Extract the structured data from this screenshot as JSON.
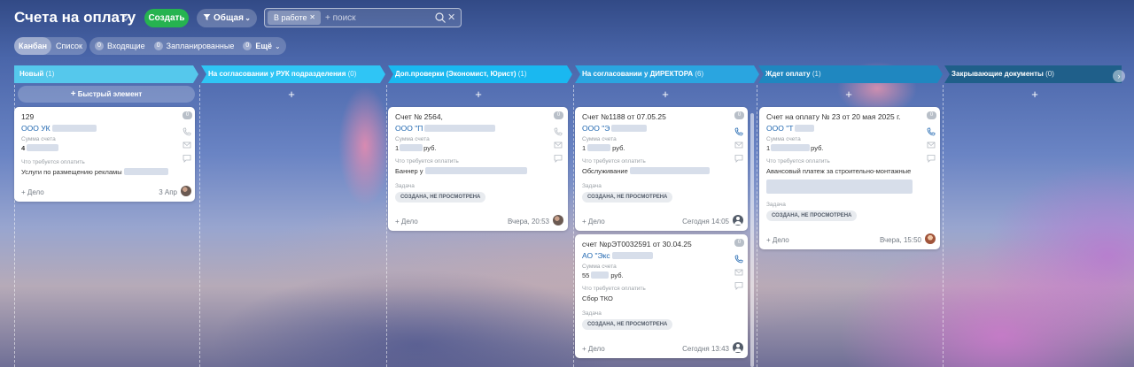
{
  "header": {
    "title": "Счета на оплату",
    "create_label": "Создать",
    "filter_label": "Общая",
    "search_chip": "В работе",
    "search_placeholder": "+ поиск"
  },
  "viewbar": {
    "views": [
      "Канбан",
      "Список"
    ],
    "counters": [
      {
        "count": "0",
        "label": "Входящие"
      },
      {
        "count": "0",
        "label": "Запланированные"
      },
      {
        "count": "0",
        "label": "Ещё"
      }
    ]
  },
  "columns": [
    {
      "title": "Новый",
      "count": "(1)",
      "color": "#55c8ec",
      "quick_add": "Быстрый элемент"
    },
    {
      "title": "На согласовании у РУК подразделения",
      "count": "(0)",
      "color": "#2fc5f5"
    },
    {
      "title": "Доп.проверки (Экономист, Юрист)",
      "count": "(1)",
      "color": "#1ab8f0"
    },
    {
      "title": "На согласовании у ДИРЕКТОРА",
      "count": "(6)",
      "color": "#2aa5e0"
    },
    {
      "title": "Ждет оплату",
      "count": "(1)",
      "color": "#1f87c0"
    },
    {
      "title": "Закрывающие документы",
      "count": "(0)",
      "color": "#1f5f8a"
    }
  ],
  "cards": {
    "new_1": {
      "badge": "0",
      "title": "129",
      "company": "ООО УК",
      "sum_label": "Сумма счета",
      "sum": "4",
      "req_label": "Что требуется оплатить",
      "req": "Услуги по размещению рекламы",
      "add_deal": "+ Дело",
      "date": "3 Апр"
    },
    "check_1": {
      "badge": "0",
      "title": "Счет № 2564,",
      "company": "ООО \"П",
      "sum_label": "Сумма счета",
      "sum": "1",
      "sum_unit": "руб.",
      "req_label": "Что требуется оплатить",
      "req": "Баннер у",
      "task_label": "Задача",
      "status": "СОЗДАНА, НЕ ПРОСМОТРЕНА",
      "add_deal": "+ Дело",
      "date": "Вчера, 20:53"
    },
    "dir_1": {
      "badge": "0",
      "title": "Счет №1188 от 07.05.25",
      "company": "ООО \"Э",
      "sum_label": "Сумма счета",
      "sum": "1",
      "sum_unit": "руб.",
      "req_label": "Что требуется оплатить",
      "req": "Обслуживание",
      "task_label": "Задача",
      "status": "СОЗДАНА, НЕ ПРОСМОТРЕНА",
      "add_deal": "+ Дело",
      "date": "Сегодня 14:05"
    },
    "dir_2": {
      "badge": "0",
      "title": "счет №рЭТ0032591 от 30.04.25",
      "company": "АО \"Экс",
      "sum_label": "Сумма счета",
      "sum": "55",
      "sum_unit": "руб.",
      "req_label": "Что требуется оплатить",
      "req": "Сбор ТКО",
      "task_label": "Задача",
      "status": "СОЗДАНА, НЕ ПРОСМОТРЕНА",
      "add_deal": "+ Дело",
      "date": "Сегодня 13:43"
    },
    "pay_1": {
      "badge": "0",
      "title": "Счет на оплату № 23 от 20 мая 2025 г.",
      "company": "ООО \"Т",
      "sum_label": "Сумма счета",
      "sum": "1",
      "sum_unit": "руб.",
      "req_label": "Что требуется оплатить",
      "req": "Авансовый платеж за строительно-монтажные",
      "task_label": "Задача",
      "status": "СОЗДАНА, НЕ ПРОСМОТРЕНА",
      "add_deal": "+ Дело",
      "date": "Вчера, 15:50"
    }
  },
  "icons": {
    "pin": "pin-icon",
    "search": "search-icon",
    "clear": "close-icon",
    "phone": "phone-icon",
    "mail": "mail-icon",
    "chat": "chat-icon"
  },
  "colors": {
    "create_button": "#26b350",
    "link": "#2067b0"
  }
}
